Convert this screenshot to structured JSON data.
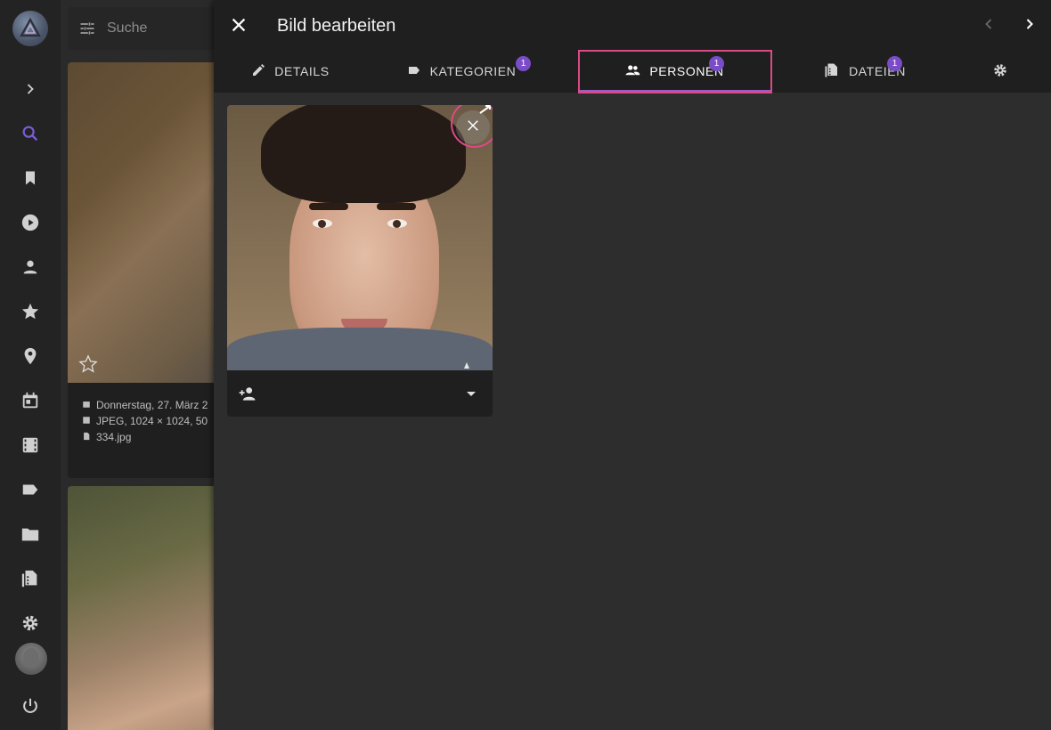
{
  "search": {
    "placeholder": "Suche"
  },
  "sidebar": {
    "items": [
      {
        "icon": "chevron-right-icon"
      },
      {
        "icon": "search-icon"
      },
      {
        "icon": "bookmark-icon"
      },
      {
        "icon": "play-circle-icon"
      },
      {
        "icon": "person-icon"
      },
      {
        "icon": "star-icon"
      },
      {
        "icon": "location-pin-icon"
      },
      {
        "icon": "calendar-icon"
      },
      {
        "icon": "film-icon"
      },
      {
        "icon": "label-icon"
      },
      {
        "icon": "folder-icon"
      },
      {
        "icon": "file-library-icon"
      },
      {
        "icon": "gear-icon"
      },
      {
        "icon": "power-icon"
      }
    ],
    "active_color": "#7b5cd6"
  },
  "background_card": {
    "date": "Donnerstag, 27. März 2",
    "file_info": "JPEG, 1024 × 1024, 50",
    "filename": "334.jpg"
  },
  "dialog": {
    "title": "Bild bearbeiten",
    "tabs": [
      {
        "label": "DETAILS",
        "icon": "pencil-icon"
      },
      {
        "label": "KATEGORIEN",
        "icon": "label-icon",
        "badge": "1"
      },
      {
        "label": "PERSONEN",
        "icon": "people-icon",
        "badge": "1",
        "active": true
      },
      {
        "label": "DATEIEN",
        "icon": "file-library-icon",
        "badge": "1"
      }
    ]
  },
  "colors": {
    "accent": "#9a5cc6",
    "badge": "#7b4cc8",
    "highlight": "#d94a86"
  }
}
